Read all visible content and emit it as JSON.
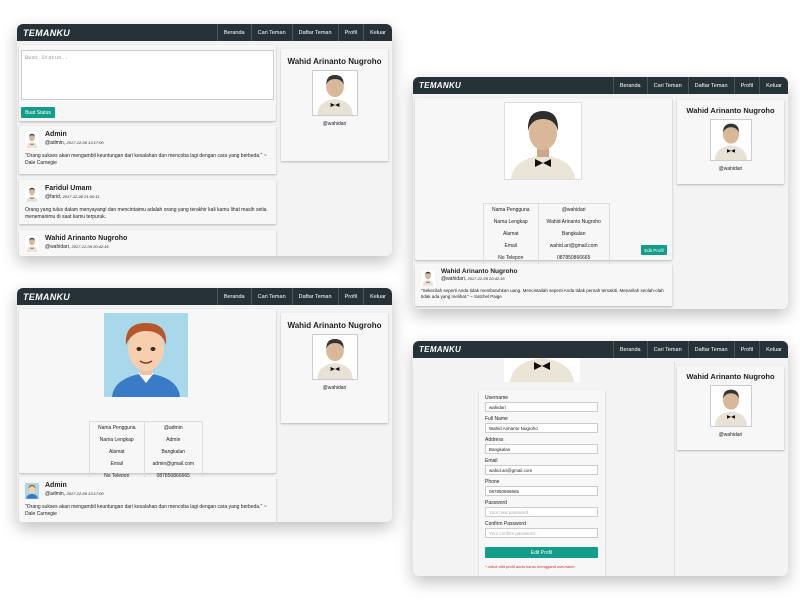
{
  "brand": "TEMANKU",
  "nav": [
    "Beranda",
    "Cari Teman",
    "Daftar Teman",
    "Profil",
    "Keluar"
  ],
  "sidebar": {
    "name": "Wahid Arinanto Nugroho",
    "username": "@wahidari"
  },
  "feed": {
    "status_placeholder": "Buat Status..",
    "post_button": "Buat Status",
    "posts": [
      {
        "name": "Admin",
        "username": "@admin",
        "time": "2017-12-06 13:17:00",
        "text": "\"Orang sukses akan mengambil keuntungan dari kesalahan dan mencoba lagi dengan cara yang berbeda.\" ~ Dale Carnegie"
      },
      {
        "name": "Faridul Umam",
        "username": "@farid",
        "time": "2017-12-08 21:00:11",
        "text": "Orang yang tulus dalam menyayangi dan mencintaimu adalah orang yang terakhir kali kamu lihat masih setia menemanimu di saat kamu terpuruk."
      },
      {
        "name": "Wahid Arinanto Nugroho",
        "username": "@wahidari",
        "time": "2017-12-09 20:42:16",
        "text": ""
      }
    ]
  },
  "admin_profile": {
    "labels": [
      "Nama Pengguna",
      "Nama Lengkap",
      "Alamat",
      "Email",
      "No Telepon"
    ],
    "values": [
      "@admin",
      "Admin",
      "Bangkalan",
      "admin@gmail.com",
      "087850866665"
    ],
    "post": {
      "name": "Admin",
      "username": "@admin",
      "time": "2017-12-06 13:17:00",
      "text": "\"Orang sukses akan mengambil keuntungan dari kesalahan dan mencoba lagi dengan cara yang berbeda.\" ~ Dale Carnegie"
    }
  },
  "my_profile": {
    "labels": [
      "Nama Pengguna",
      "Nama Lengkap",
      "Alamat",
      "Email",
      "No Telepon"
    ],
    "values": [
      "@wahidari",
      "Wahid Arinanto Nugroho",
      "Bangkalan",
      "wahid.ari@gmail.com",
      "087850866665"
    ],
    "edit_button": "Edit Profil",
    "post": {
      "name": "Wahid Arinanto Nugroho",
      "username": "@wahidari",
      "time": "2017-12-09 20:42:16",
      "text": "\"Sekecilah seperti Anda tidak membutuhkan uang. Mencintailah seperti Anda tidak pernah tersakiti. Menarilah seolah-olah tidak ada yang melihat.\" ~ Satchel Paige"
    }
  },
  "edit_form": {
    "fields": [
      {
        "label": "Username",
        "value": "wahidari",
        "placeholder": ""
      },
      {
        "label": "Full Name",
        "value": "Wahid Arinanto Nugroho",
        "placeholder": ""
      },
      {
        "label": "Address",
        "value": "Bangkalan",
        "placeholder": ""
      },
      {
        "label": "Email",
        "value": "wahid.ari@gmail.com",
        "placeholder": ""
      },
      {
        "label": "Phone",
        "value": "087850866665",
        "placeholder": ""
      },
      {
        "label": "Password",
        "value": "",
        "placeholder": "Your new password.."
      },
      {
        "label": "Confirm Password",
        "value": "",
        "placeholder": "Your confirm password.."
      }
    ],
    "submit": "Edit Profil",
    "note": "* untuk edit profil anda harus mengganti username"
  },
  "colors": {
    "topbar": "#263238",
    "accent": "#139e8b",
    "window_bg": "#f3f3f3"
  }
}
